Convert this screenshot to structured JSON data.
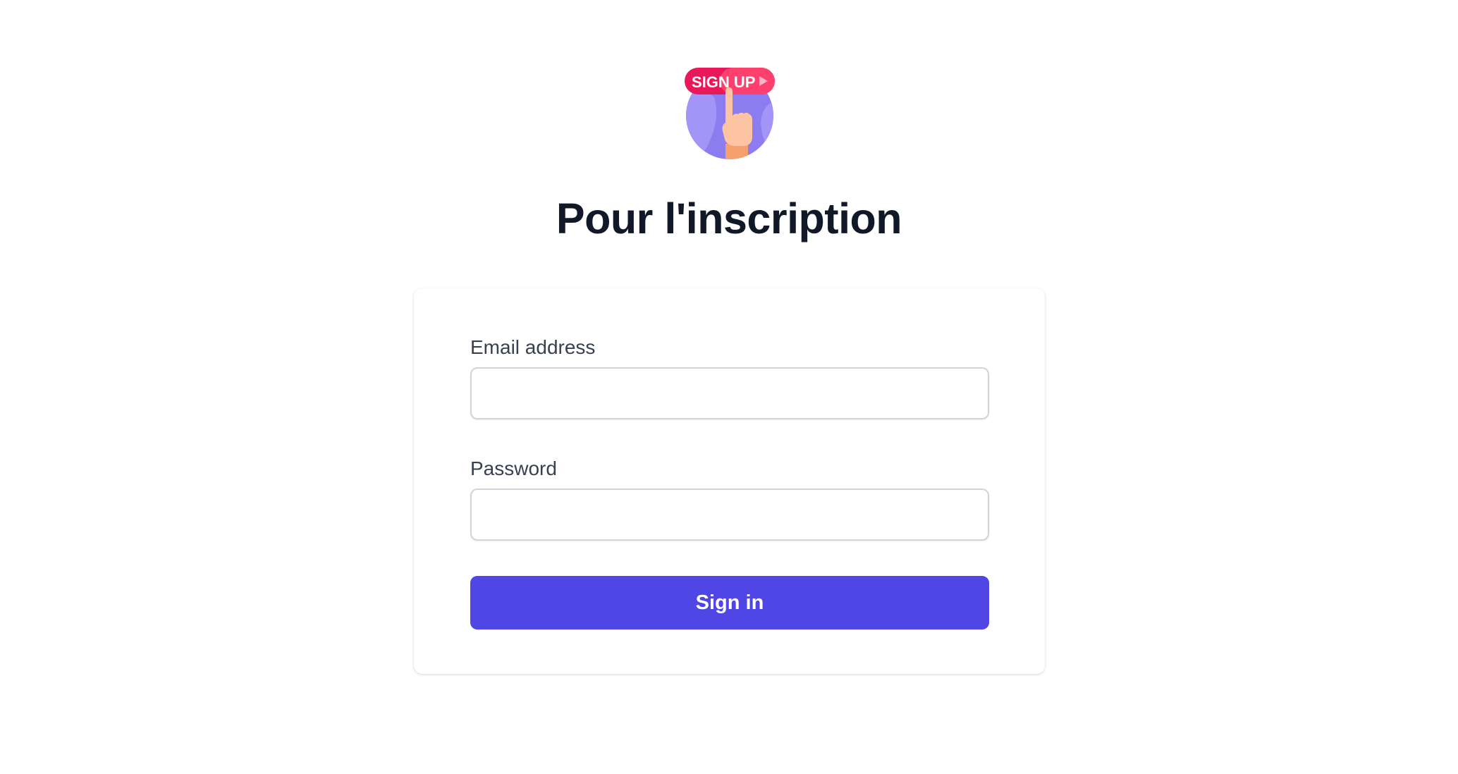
{
  "logo": {
    "badge_text": "SIGN UP",
    "icon": "signup-hand-icon",
    "colors": {
      "badge": "#e8185b",
      "circle": "#8c7cf0",
      "hand": "#fdc4a3"
    }
  },
  "header": {
    "title": "Pour l'inscription"
  },
  "form": {
    "email_label": "Email address",
    "email_value": "",
    "password_label": "Password",
    "password_value": "",
    "submit_label": "Sign in"
  },
  "theme": {
    "accent": "#4f46e5",
    "title_color": "#111827",
    "label_color": "#374151"
  }
}
